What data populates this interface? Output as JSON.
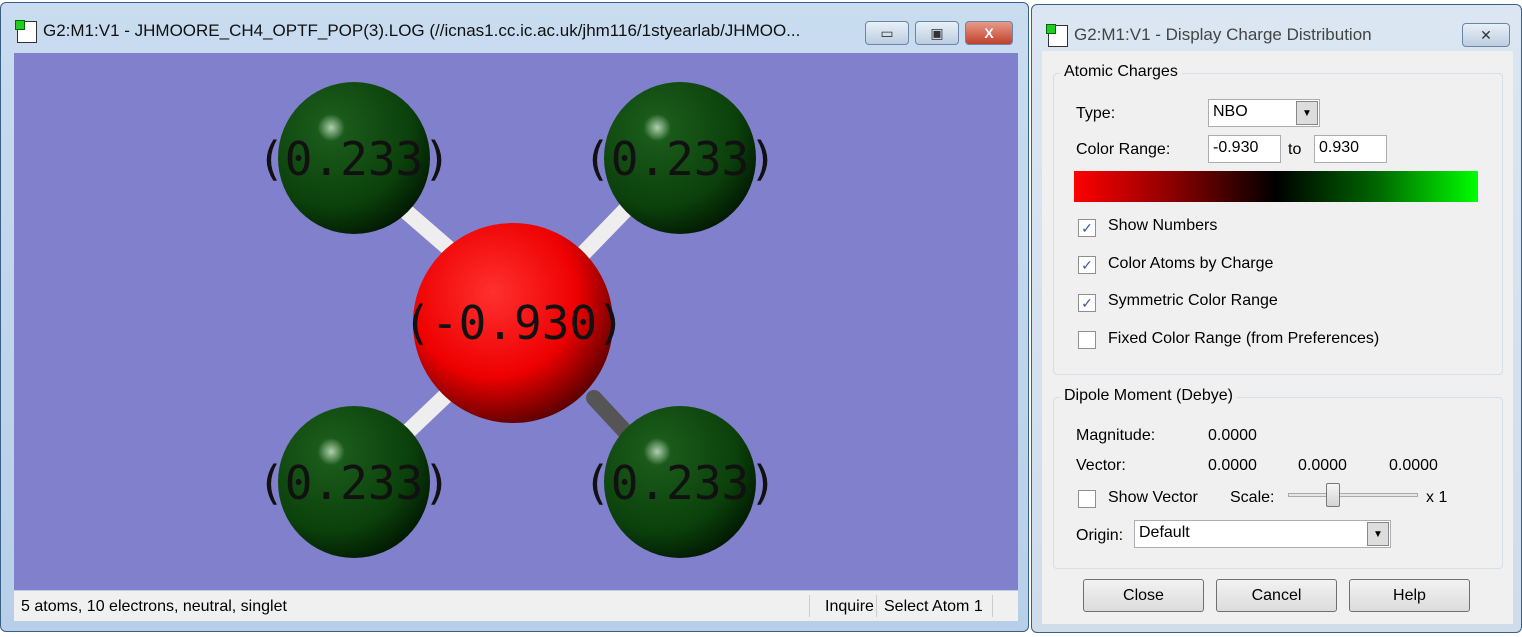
{
  "main_window": {
    "title": "G2:M1:V1 - JHMOORE_CH4_OPTF_POP(3).LOG (//icnas1.cc.ic.ac.uk/jhm116/1styearlab/JHMOO...",
    "minimize": "▭",
    "maximize": "▣",
    "close": "X"
  },
  "molecule": {
    "carbon_label": "(-0.930)",
    "hydrogen_labels": [
      "(0.233)",
      "(0.233)",
      "(0.233)",
      "(0.233)"
    ],
    "colors": {
      "carbon": "#ff0000",
      "hydrogen": "#0a4a0a",
      "background": "#8080cc"
    }
  },
  "status": {
    "info": "5 atoms, 10 electrons, neutral, singlet",
    "mode": "Inquire",
    "action": "Select Atom 1"
  },
  "dialog": {
    "title": "G2:M1:V1 - Display Charge Distribution",
    "close": "✕",
    "atomic_charges": {
      "title": "Atomic Charges",
      "type_label": "Type:",
      "type_value": "NBO",
      "range_label": "Color Range:",
      "range_min": "-0.930",
      "to": "to",
      "range_max": "0.930",
      "checkboxes": [
        {
          "label": "Show Numbers",
          "checked": true
        },
        {
          "label": "Color Atoms by Charge",
          "checked": true
        },
        {
          "label": "Symmetric Color Range",
          "checked": true
        },
        {
          "label": "Fixed Color Range (from Preferences)",
          "checked": false
        }
      ]
    },
    "dipole": {
      "title": "Dipole Moment (Debye)",
      "magnitude_label": "Magnitude:",
      "magnitude": "0.0000",
      "vector_label": "Vector:",
      "vector": [
        "0.0000",
        "0.0000",
        "0.0000"
      ],
      "show_vector": "Show Vector",
      "scale_label": "Scale:",
      "scale_value": "x 1",
      "origin_label": "Origin:",
      "origin_value": "Default"
    },
    "buttons": {
      "close": "Close",
      "cancel": "Cancel",
      "help": "Help"
    }
  }
}
